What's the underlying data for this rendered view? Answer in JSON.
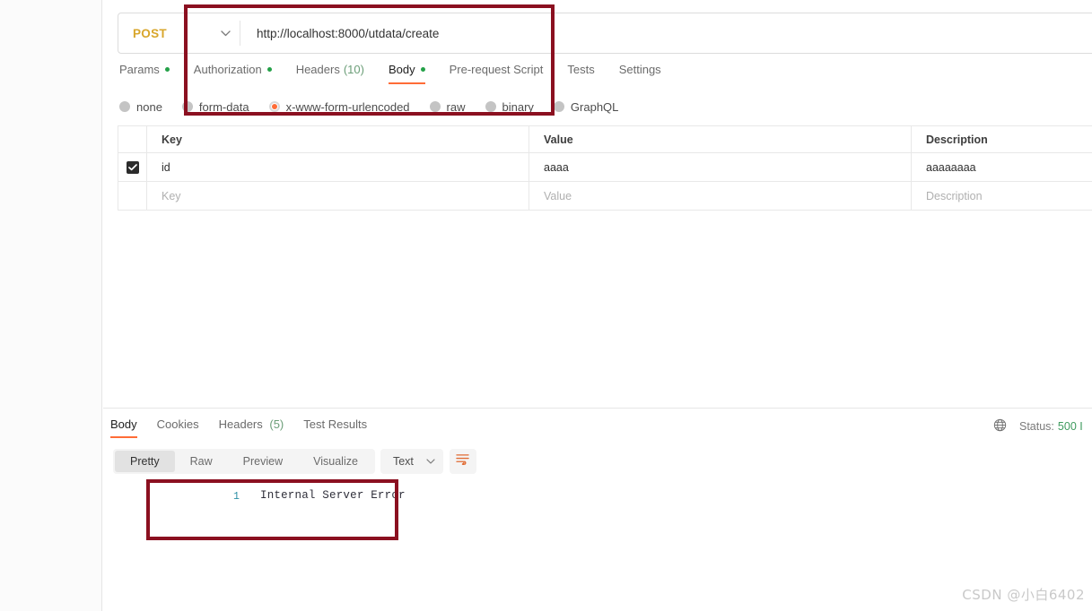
{
  "request": {
    "method": "POST",
    "url": "http://localhost:8000/utdata/create",
    "tabs": [
      {
        "label": "Params",
        "dot": true,
        "count": ""
      },
      {
        "label": "Authorization",
        "dot": true,
        "count": ""
      },
      {
        "label": "Headers",
        "dot": false,
        "count": "(10)"
      },
      {
        "label": "Body",
        "dot": true,
        "count": ""
      },
      {
        "label": "Pre-request Script",
        "dot": false,
        "count": ""
      },
      {
        "label": "Tests",
        "dot": false,
        "count": ""
      },
      {
        "label": "Settings",
        "dot": false,
        "count": ""
      }
    ],
    "active_tab": "Body",
    "body_types": [
      {
        "label": "none",
        "selected": false
      },
      {
        "label": "form-data",
        "selected": false
      },
      {
        "label": "x-www-form-urlencoded",
        "selected": true
      },
      {
        "label": "raw",
        "selected": false
      },
      {
        "label": "binary",
        "selected": false
      },
      {
        "label": "GraphQL",
        "selected": false
      }
    ],
    "table": {
      "headers": [
        "Key",
        "Value",
        "Description"
      ],
      "rows": [
        {
          "checked": true,
          "key": "id",
          "value": "aaaa",
          "description": "aaaaaaaa",
          "placeholder": false
        }
      ],
      "placeholder_row": {
        "key": "Key",
        "value": "Value",
        "description": "Description"
      }
    }
  },
  "response": {
    "tabs": [
      {
        "label": "Body",
        "count": ""
      },
      {
        "label": "Cookies",
        "count": ""
      },
      {
        "label": "Headers",
        "count": "(5)"
      },
      {
        "label": "Test Results",
        "count": ""
      }
    ],
    "active_tab": "Body",
    "status_label": "Status:",
    "status_code": "500 I",
    "view_modes": [
      "Pretty",
      "Raw",
      "Preview",
      "Visualize"
    ],
    "active_view": "Pretty",
    "format": "Text",
    "body_lines": [
      {
        "number": "1",
        "text": "Internal Server Error"
      }
    ]
  },
  "watermark": "CSDN @小白6402",
  "colors": {
    "accent": "#ff6c37",
    "method": "#d8a62b",
    "status_ok": "#3f9b5f",
    "annotation": "#8b1020",
    "dot_green": "#24a148"
  }
}
